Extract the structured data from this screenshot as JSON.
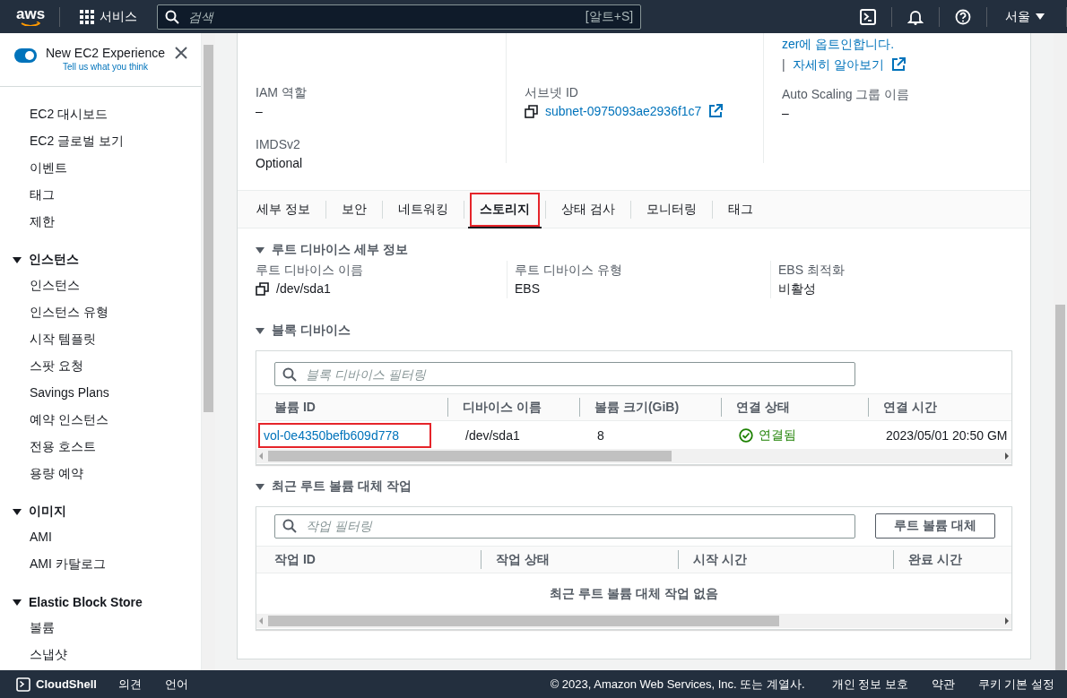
{
  "nav": {
    "logo": "aws",
    "services": "서비스",
    "search_placeholder": "검색",
    "shortcut": "[알트+S]",
    "region": "서울"
  },
  "sidebar": {
    "experience": {
      "label": "New EC2 Experience",
      "link": "Tell us what you think",
      "on": true
    },
    "groups": [
      {
        "items": [
          "EC2 대시보드",
          "EC2 글로벌 보기",
          "이벤트",
          "태그",
          "제한"
        ]
      },
      {
        "title": "인스턴스",
        "expanded": true,
        "items": [
          "인스턴스",
          "인스턴스 유형",
          "시작 템플릿",
          "스팟 요청",
          "Savings Plans",
          "예약 인스턴스",
          "전용 호스트",
          "용량 예약"
        ]
      },
      {
        "title": "이미지",
        "expanded": true,
        "items": [
          "AMI",
          "AMI 카탈로그"
        ]
      },
      {
        "title": "Elastic Block Store",
        "expanded": true,
        "items": [
          "볼륨",
          "스냅샷"
        ]
      }
    ]
  },
  "details": {
    "notice": {
      "text": "zer에 옵트인합니다.",
      "separator": "|",
      "link": "자세히 알아보기"
    },
    "rows": [
      [
        {
          "label": "IAM 역할",
          "value": "–",
          "kind": "text"
        },
        {
          "label": "서브넷 ID",
          "value": "subnet-0975093ae2936f1c7",
          "kind": "link"
        },
        {
          "label": "Auto Scaling 그룹 이름",
          "value": "–",
          "kind": "text"
        }
      ],
      [
        {
          "label": "IMDSv2",
          "value": "Optional",
          "kind": "text"
        }
      ]
    ]
  },
  "tabs": [
    {
      "label": "세부 정보",
      "selected": false,
      "highlighted": false
    },
    {
      "label": "보안",
      "selected": false,
      "highlighted": false
    },
    {
      "label": "네트워킹",
      "selected": false,
      "highlighted": false
    },
    {
      "label": "스토리지",
      "selected": true,
      "highlighted": true
    },
    {
      "label": "상태 검사",
      "selected": false,
      "highlighted": false
    },
    {
      "label": "모니터링",
      "selected": false,
      "highlighted": false
    },
    {
      "label": "태그",
      "selected": false,
      "highlighted": false
    }
  ],
  "root_device": {
    "title": "루트 디바이스 세부 정보",
    "expanded": true,
    "fields": [
      {
        "label": "루트 디바이스 이름",
        "value": "/dev/sda1",
        "copy": true
      },
      {
        "label": "루트 디바이스 유형",
        "value": "EBS",
        "copy": false
      },
      {
        "label": "EBS 최적화",
        "value": "비활성",
        "copy": false
      }
    ]
  },
  "block_devices": {
    "title": "블록 디바이스",
    "expanded": true,
    "filter_placeholder": "블록 디바이스 필터링",
    "columns": [
      "볼륨 ID",
      "디바이스 이름",
      "볼륨 크기(GiB)",
      "연결 상태",
      "연결 시간"
    ],
    "rows": [
      {
        "volume_id": "vol-0e4350befb609d778",
        "highlighted": true,
        "device": "/dev/sda1",
        "size": "8",
        "status": {
          "text": "연결됨",
          "kind": "ok"
        },
        "time": "2023/05/01 20:50 GM"
      }
    ]
  },
  "replace_tasks": {
    "title": "최근 루트 볼륨 대체 작업",
    "expanded": true,
    "filter_placeholder": "작업 필터링",
    "button": "루트 볼륨 대체",
    "columns": [
      "작업 ID",
      "작업 상태",
      "시작 시간",
      "완료 시간"
    ],
    "empty": "최근 루트 볼륨 대체 작업 없음"
  },
  "footer": {
    "cloudshell": "CloudShell",
    "links_left": [
      "의견",
      "언어"
    ],
    "copyright": "© 2023, Amazon Web Services, Inc. 또는 계열사.",
    "links_right": [
      "개인 정보 보호",
      "약관",
      "쿠키 기본 설정"
    ]
  }
}
